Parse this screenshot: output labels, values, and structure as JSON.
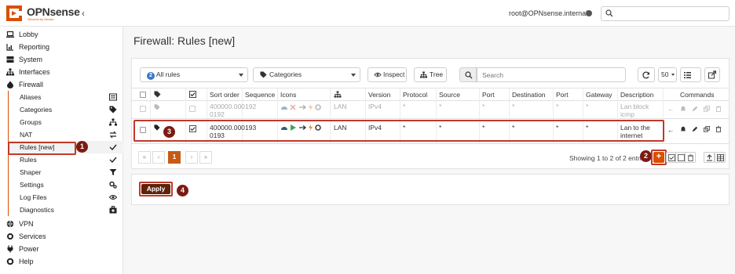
{
  "app": {
    "logo_text": "OPNsense",
    "logo_tagline": "Secured by Deciso",
    "user": "root@OPNsense.internal",
    "search_placeholder": ""
  },
  "sidebar": {
    "items": [
      {
        "label": "Lobby",
        "icon": "laptop-icon"
      },
      {
        "label": "Reporting",
        "icon": "chart-icon"
      },
      {
        "label": "System",
        "icon": "server-icon"
      },
      {
        "label": "Interfaces",
        "icon": "sitemap-icon"
      },
      {
        "label": "Firewall",
        "icon": "fire-icon"
      },
      {
        "label": "VPN",
        "icon": "globe-icon"
      },
      {
        "label": "Services",
        "icon": "gears-icon"
      },
      {
        "label": "Power",
        "icon": "plug-icon"
      },
      {
        "label": "Help",
        "icon": "lifebuoy-icon"
      }
    ],
    "firewall_sub": [
      {
        "label": "Aliases",
        "icon": "list-icon"
      },
      {
        "label": "Categories",
        "icon": "tags-icon"
      },
      {
        "label": "Groups",
        "icon": "sitemap-icon"
      },
      {
        "label": "NAT",
        "icon": "exchange-icon"
      },
      {
        "label": "Rules [new]",
        "icon": "check-icon"
      },
      {
        "label": "Rules",
        "icon": "check-icon"
      },
      {
        "label": "Shaper",
        "icon": "filter-icon"
      },
      {
        "label": "Settings",
        "icon": "cogs-icon"
      },
      {
        "label": "Log Files",
        "icon": "eye-icon"
      },
      {
        "label": "Diagnostics",
        "icon": "medkit-icon"
      }
    ]
  },
  "page": {
    "title": "Firewall: Rules [new]"
  },
  "toolbar": {
    "interface_count": "2",
    "interface_label": "All rules",
    "categories_label": "Categories",
    "inspect_label": "Inspect",
    "tree_label": "Tree",
    "search_placeholder": "Search",
    "page_size": "50"
  },
  "table": {
    "headers": [
      "Sort order",
      "Sequence",
      "Icons",
      "Version",
      "Protocol",
      "Source",
      "Port",
      "Destination",
      "Port",
      "Gateway",
      "Description",
      "Commands"
    ],
    "rows": [
      {
        "sort_order_1": "400000.000",
        "sort_order_2": "0192",
        "sequence": "192",
        "interface": "LAN",
        "version": "IPv4",
        "protocol": "*",
        "source": "*",
        "port": "*",
        "destination": "*",
        "dport": "*",
        "gateway": "*",
        "desc_1": "Lan block",
        "desc_2": "icmp"
      },
      {
        "sort_order_1": "400000.000",
        "sort_order_2": "0193",
        "sequence": "193",
        "interface": "LAN",
        "version": "IPv4",
        "protocol": "*",
        "source": "*",
        "port": "*",
        "destination": "*",
        "dport": "*",
        "gateway": "*",
        "desc_1": "Lan to the",
        "desc_2": "internet"
      }
    ]
  },
  "pagination": {
    "first": "«",
    "prev": "‹",
    "current": "1",
    "next": "›",
    "last": "»",
    "showing": "Showing 1 to 2 of 2 entries"
  },
  "actions": {
    "add": "+",
    "apply": "Apply"
  },
  "callouts": [
    "1",
    "2",
    "3",
    "4"
  ],
  "colors": {
    "accent": "#d94f00",
    "callout": "#7b1b12",
    "highlight": "#c0392b",
    "apply": "#5e2209"
  }
}
